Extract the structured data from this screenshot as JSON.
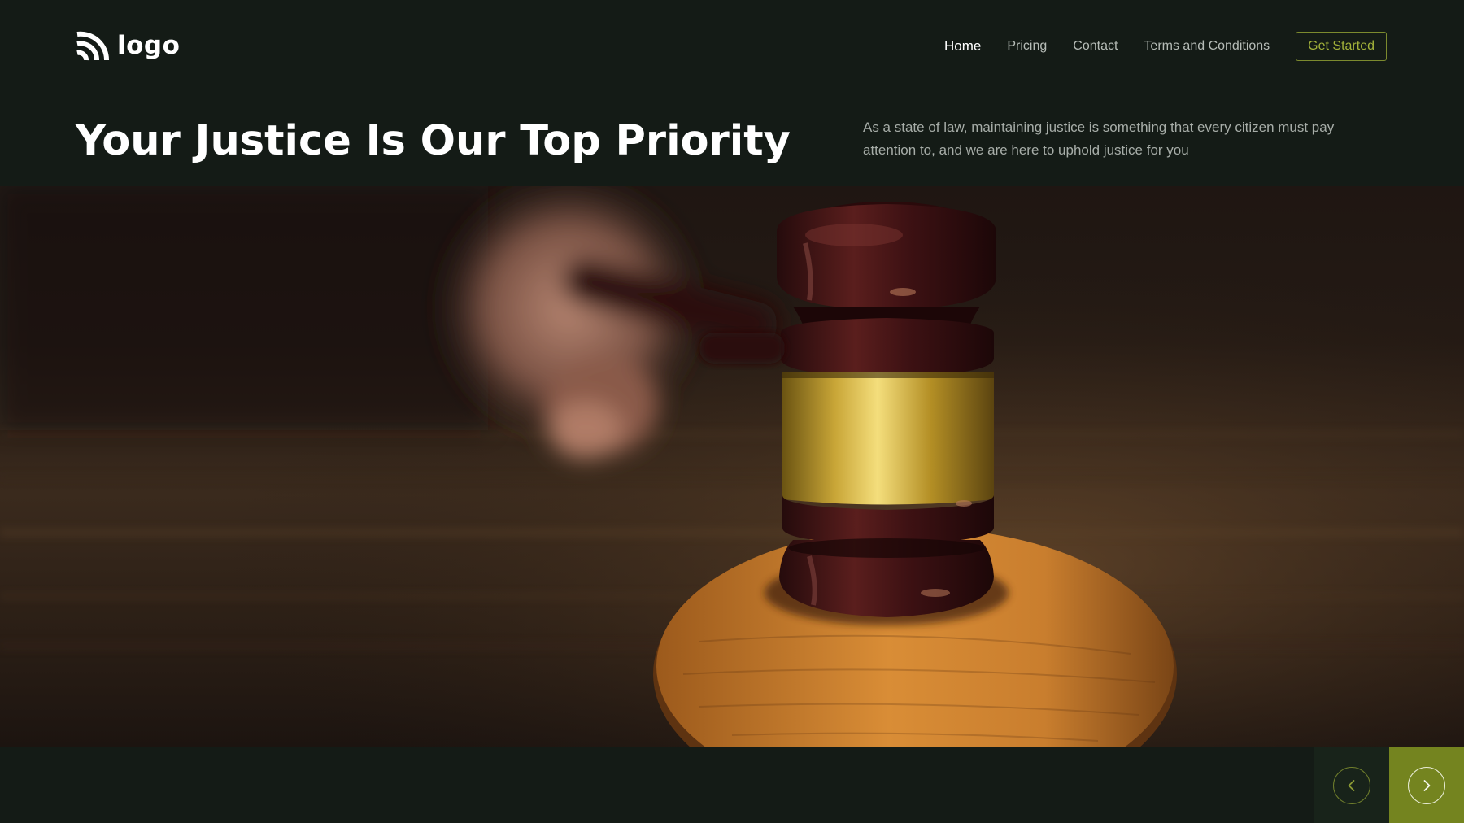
{
  "brand": {
    "logo_text": "logo"
  },
  "nav": {
    "items": [
      {
        "label": "Home",
        "active": true
      },
      {
        "label": "Pricing",
        "active": false
      },
      {
        "label": "Contact",
        "active": false
      },
      {
        "label": "Terms and Conditions",
        "active": false
      }
    ],
    "cta_label": "Get Started"
  },
  "hero": {
    "title": "Your Justice Is Our Top Priority",
    "description": "As a state of law, maintaining justice is something that every citizen must pay attention to, and we are here to uphold justice for you",
    "image_subject": "judge gavel on sound block"
  },
  "slider": {
    "prev_icon": "chevron-left-icon",
    "next_icon": "chevron-right-icon"
  },
  "colors": {
    "background": "#141b16",
    "accent": "#74841f",
    "accent_text": "#a3b23a",
    "muted_text": "#a7ada8"
  }
}
